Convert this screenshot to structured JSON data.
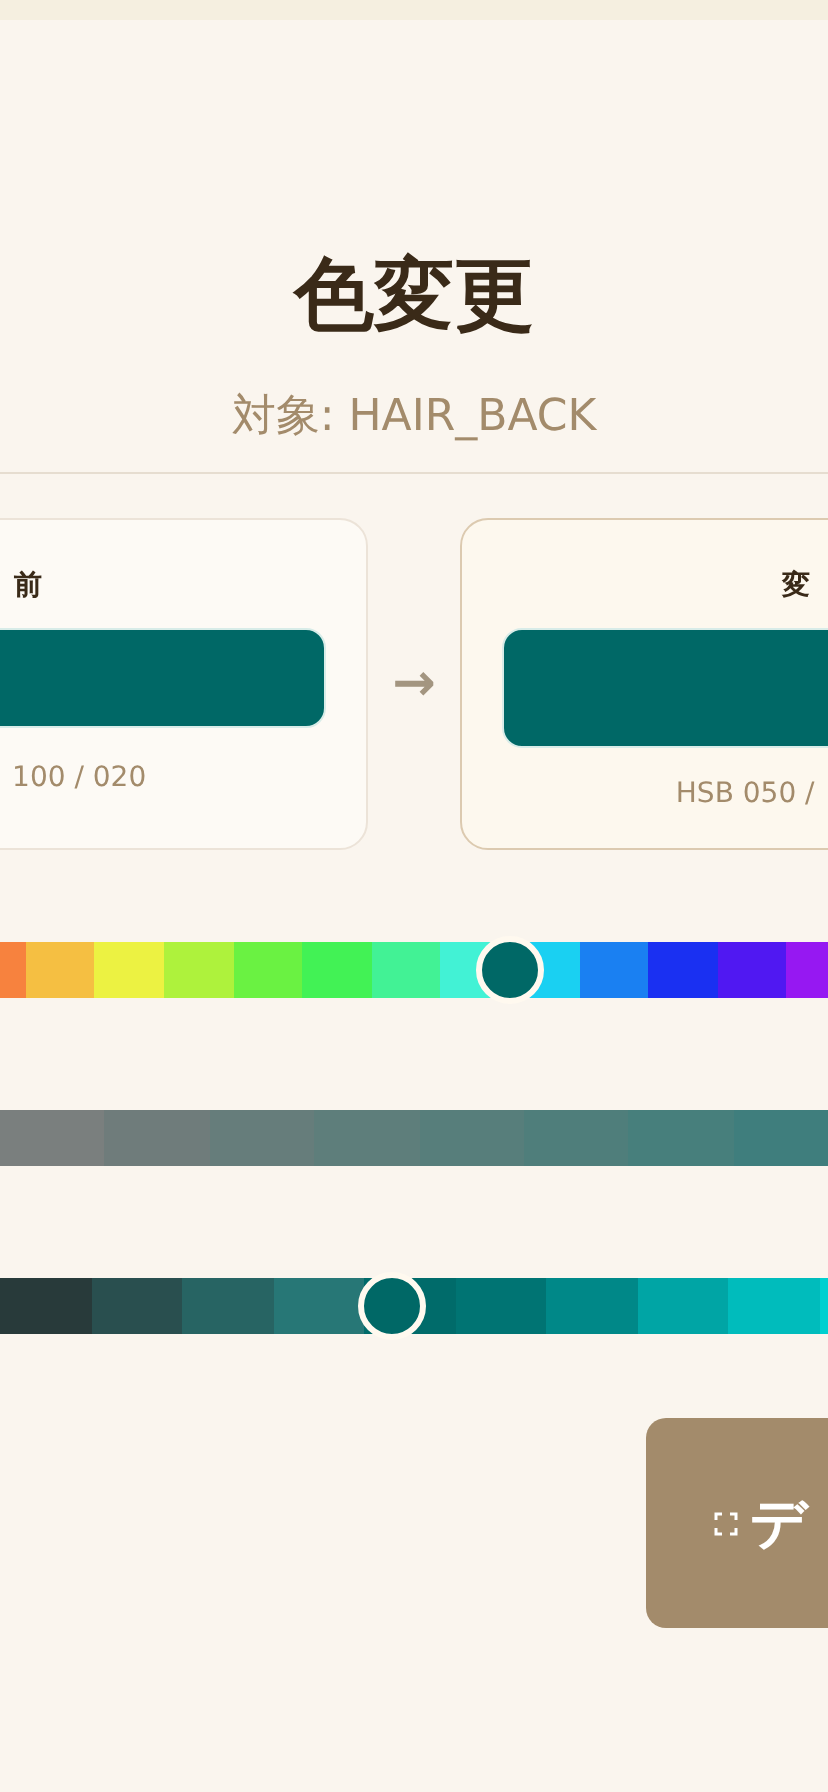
{
  "title": "色変更",
  "subtitle": "対象: HAIR_BACK",
  "cards": [
    {
      "label": "前",
      "color": "#006866",
      "reading": "100 / 020"
    },
    {
      "label": "変",
      "color": "#006866",
      "reading": "HSB 050 /"
    }
  ],
  "arrow": "→",
  "sliders": [
    {
      "kind": "hue",
      "level": 0.616
    },
    {
      "kind": "saturation"
    },
    {
      "kind": "brightness",
      "level": 0.474
    }
  ],
  "button": {
    "label": "デ"
  }
}
